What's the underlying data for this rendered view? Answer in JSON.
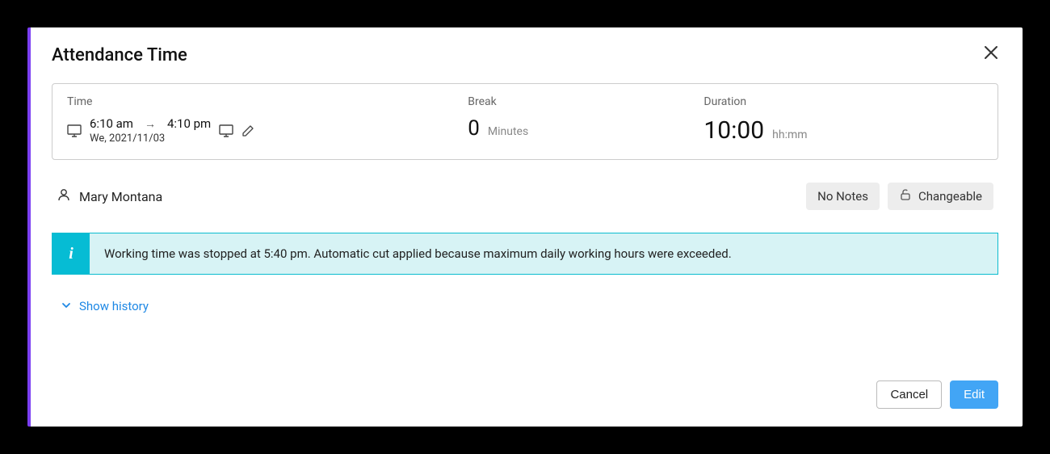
{
  "modal": {
    "title": "Attendance Time"
  },
  "summary": {
    "time_label": "Time",
    "start_time": "6:10 am",
    "end_time": "4:10 pm",
    "date": "We, 2021/11/03",
    "break_label": "Break",
    "break_value": "0",
    "break_unit": "Minutes",
    "duration_label": "Duration",
    "duration_value": "10:00",
    "duration_unit": "hh:mm"
  },
  "person": {
    "name": "Mary Montana"
  },
  "badges": {
    "no_notes": "No Notes",
    "changeable": "Changeable"
  },
  "info": {
    "message": "Working time was stopped at 5:40 pm. Automatic cut applied because maximum daily working hours were exceeded."
  },
  "history": {
    "label": "Show history"
  },
  "buttons": {
    "cancel": "Cancel",
    "edit": "Edit"
  }
}
